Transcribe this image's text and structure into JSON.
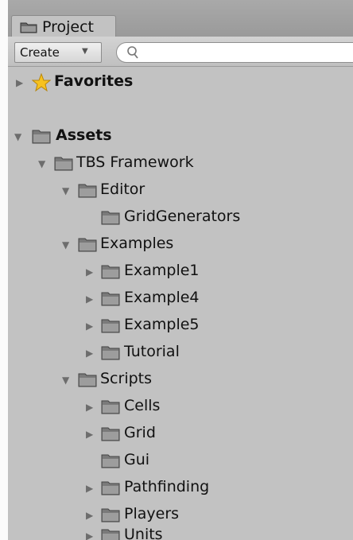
{
  "window": {
    "tab_label": "Project",
    "tab_icon": "folder-icon"
  },
  "toolbar": {
    "create_label": "Create",
    "search_value": "",
    "search_placeholder": ""
  },
  "tree": {
    "favorites": {
      "label": "Favorites",
      "icon": "star-icon",
      "expanded": false
    },
    "assets": {
      "label": "Assets",
      "icon": "folder-icon",
      "expanded": true
    },
    "tbs_framework": {
      "label": "TBS Framework",
      "expanded": true
    },
    "editor": {
      "label": "Editor",
      "expanded": true
    },
    "grid_generators": {
      "label": "GridGenerators"
    },
    "examples": {
      "label": "Examples",
      "expanded": true
    },
    "example1": {
      "label": "Example1",
      "expanded": false
    },
    "example4": {
      "label": "Example4",
      "expanded": false
    },
    "example5": {
      "label": "Example5",
      "expanded": false
    },
    "tutorial": {
      "label": "Tutorial",
      "expanded": false
    },
    "scripts": {
      "label": "Scripts",
      "expanded": true
    },
    "cells": {
      "label": "Cells",
      "expanded": false
    },
    "grid": {
      "label": "Grid",
      "expanded": false
    },
    "gui": {
      "label": "Gui"
    },
    "pathfinding": {
      "label": "Pathfinding",
      "expanded": false
    },
    "players": {
      "label": "Players",
      "expanded": false
    },
    "units": {
      "label": "Units",
      "expanded": false
    }
  },
  "colors": {
    "panel_bg": "#c2c2c2",
    "folder_fill": "#8a8a8a",
    "star_fill": "#f7c21f"
  }
}
